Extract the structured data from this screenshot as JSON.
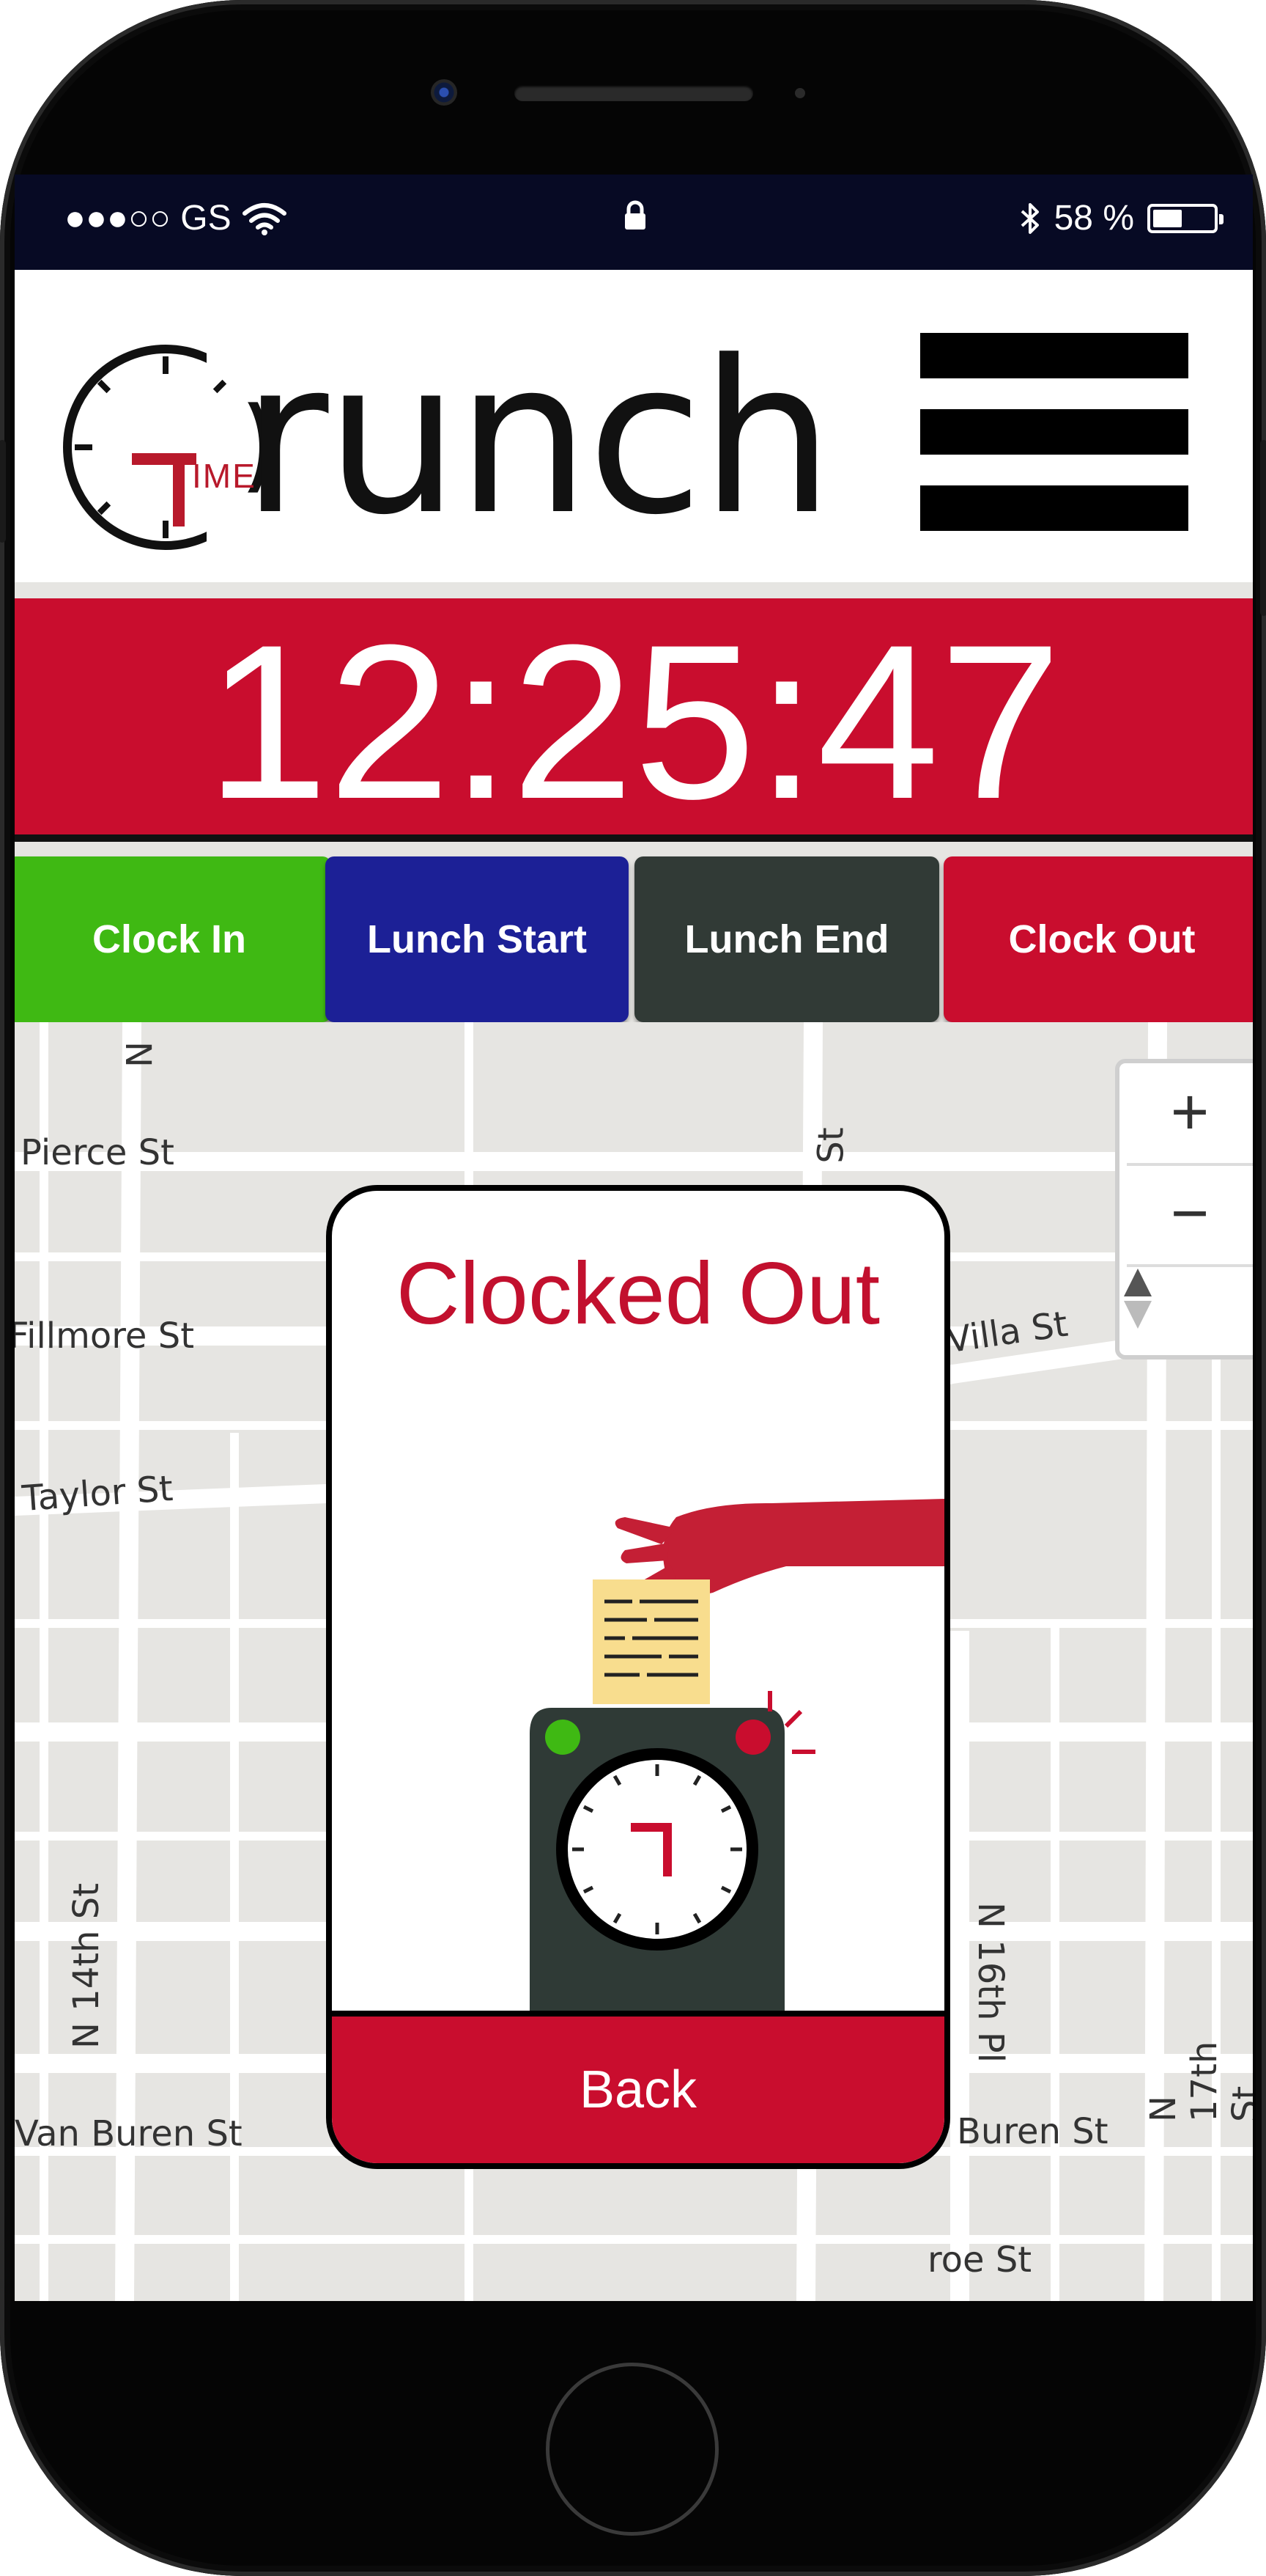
{
  "status_bar": {
    "carrier": "●●●○○ GS",
    "battery_percent": "58 %",
    "battery_level": 0.58
  },
  "app": {
    "logo_small": "IME",
    "logo_text": "runch"
  },
  "timer": {
    "value": "12:25:47"
  },
  "actions": [
    {
      "label": "Clock In",
      "color": "#3fb913"
    },
    {
      "label": "Lunch Start",
      "color": "#1c2096"
    },
    {
      "label": "Lunch End",
      "color": "#313a36"
    },
    {
      "label": "Clock Out",
      "color": "#c90d2e"
    }
  ],
  "map": {
    "streets": [
      "N",
      "Pierce St",
      "St",
      "Fillmore St",
      "Villa St",
      "Taylor St",
      "N 14th St",
      "N 16th Pl",
      "N 17th St",
      "Van Buren St",
      "Buren St",
      "roe St"
    ],
    "zoom_in": "+",
    "zoom_out": "−"
  },
  "modal": {
    "title": "Clocked Out",
    "back_label": "Back"
  },
  "colors": {
    "brand_red": "#c90d2e",
    "status_bg": "#070a24"
  }
}
